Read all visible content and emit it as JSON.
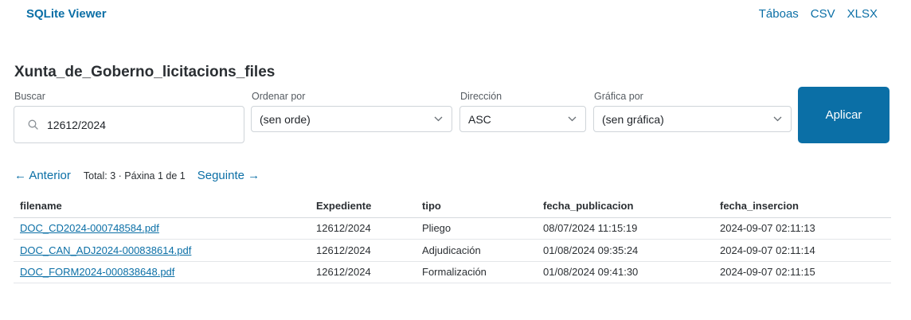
{
  "app": {
    "brand": "SQLite Viewer",
    "nav": [
      "Táboas",
      "CSV",
      "XLSX"
    ]
  },
  "page": {
    "title": "Xunta_de_Goberno_licitacions_files"
  },
  "filters": {
    "search": {
      "label": "Buscar",
      "value": "12612/2024",
      "icon": "search-icon"
    },
    "order": {
      "label": "Ordenar por",
      "value": "(sen orde)"
    },
    "direction": {
      "label": "Dirección",
      "value": "ASC"
    },
    "chart": {
      "label": "Gráfica por",
      "value": "(sen gráfica)"
    },
    "apply_label": "Aplicar"
  },
  "pager": {
    "prev": "← Anterior",
    "status": "Total: 3 · Páxina 1 de 1",
    "next": "Seguinte →"
  },
  "table": {
    "columns": [
      "filename",
      "Expediente",
      "tipo",
      "fecha_publicacion",
      "fecha_insercion"
    ],
    "rows": [
      [
        "DOC_CD2024-000748584.pdf",
        "12612/2024",
        "Pliego",
        "08/07/2024 11:15:19",
        "2024-09-07 02:11:13"
      ],
      [
        "DOC_CAN_ADJ2024-000838614.pdf",
        "12612/2024",
        "Adjudicación",
        "01/08/2024 09:35:24",
        "2024-09-07 02:11:14"
      ],
      [
        "DOC_FORM2024-000838648.pdf",
        "12612/2024",
        "Formalización",
        "01/08/2024 09:41:30",
        "2024-09-07 02:11:15"
      ]
    ]
  },
  "colors": {
    "accent": "#0b6fa6",
    "text": "#2b2f33",
    "border": "#cfd4d9"
  }
}
